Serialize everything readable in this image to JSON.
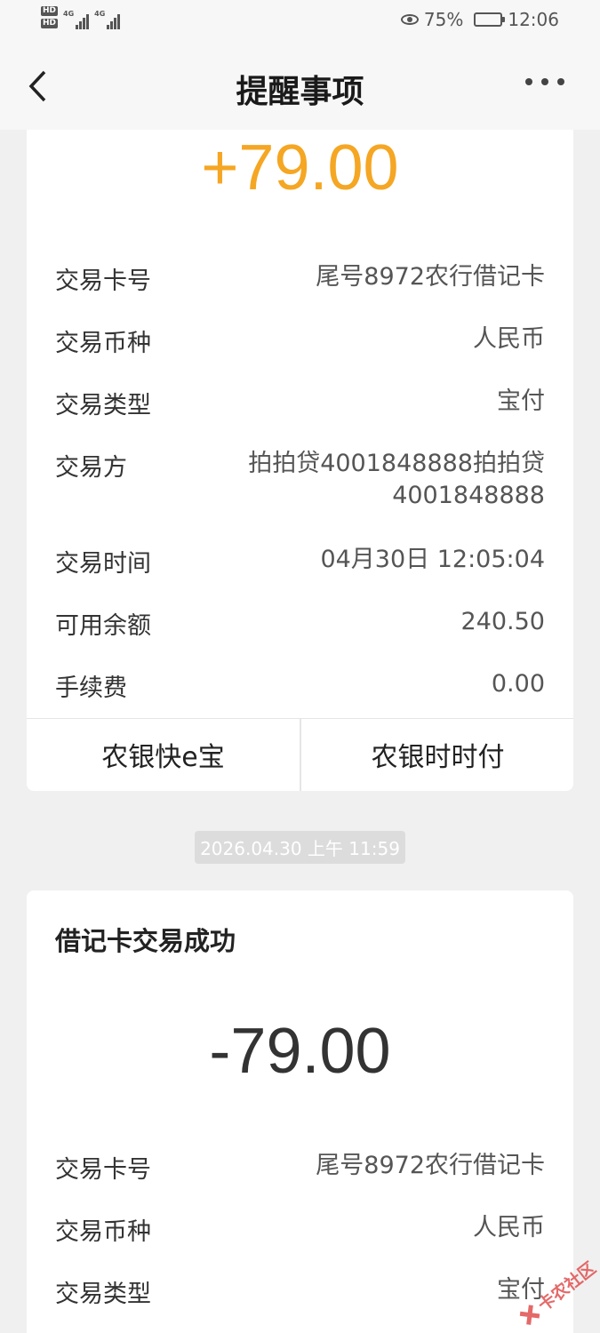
{
  "status_bar": {
    "hd1": "HD",
    "hd2": "HD",
    "net1": "4G",
    "net2": "4G",
    "battery_percent": "75%",
    "battery_level": 0.75,
    "time": "12:06",
    "icons": [
      "eye-icon",
      "battery-icon",
      "signal-icon"
    ]
  },
  "header": {
    "title": "提醒事项",
    "back_icon": "chevron-left-icon",
    "more_icon": "more-dots-icon"
  },
  "card1": {
    "amount": "+79.00",
    "amount_color": "#f5a623",
    "rows": [
      {
        "label": "交易卡号",
        "value": "尾号8972农行借记卡"
      },
      {
        "label": "交易币种",
        "value": "人民币"
      },
      {
        "label": "交易类型",
        "value": "宝付"
      },
      {
        "label": "交易方",
        "value_line1": "拍拍贷4001848888拍拍贷",
        "value_line2": "4001848888"
      },
      {
        "label": "交易时间",
        "value": "04月30日 12:05:04"
      },
      {
        "label": "可用余额",
        "value": "240.50"
      },
      {
        "label": "手续费",
        "value": "0.00"
      }
    ],
    "buttons": [
      "农银快e宝",
      "农银时时付"
    ]
  },
  "timestamp": "2026.04.30 上午 11:59",
  "card2": {
    "title": "借记卡交易成功",
    "amount": "-79.00",
    "rows": [
      {
        "label": "交易卡号",
        "value": "尾号8972农行借记卡"
      },
      {
        "label": "交易币种",
        "value": "人民币"
      },
      {
        "label": "交易类型",
        "value": "宝付"
      }
    ]
  },
  "watermark": "卡农社区"
}
